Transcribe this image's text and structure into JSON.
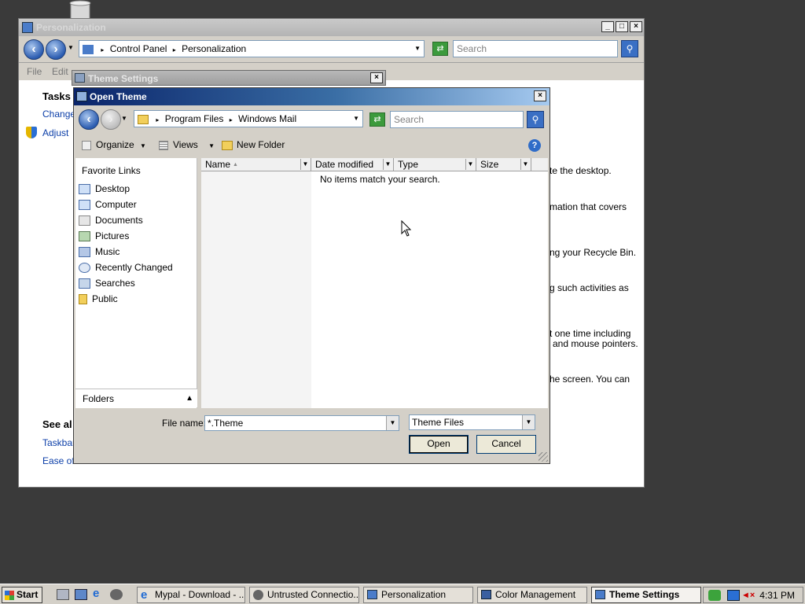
{
  "personalization": {
    "title": "Personalization",
    "address": {
      "crumb1": "Control Panel",
      "crumb2": "Personalization"
    },
    "search_placeholder": "Search",
    "menu": {
      "file": "File",
      "edit": "Edit"
    },
    "tasks_heading": "Tasks",
    "task_links": [
      "Change",
      "Adjust"
    ],
    "see_also": "See al",
    "see_also_links": [
      "Taskbar",
      "Ease of"
    ],
    "right_text": [
      "te the desktop.",
      "mation that covers",
      "ng your Recycle Bin.",
      "g such activities as",
      "t one time including",
      "and mouse pointers.",
      "he screen. You can"
    ]
  },
  "theme_settings": {
    "title": "Theme Settings"
  },
  "open_theme": {
    "title": "Open Theme",
    "address": {
      "crumb1": "Program Files",
      "crumb2": "Windows Mail"
    },
    "search_placeholder": "Search",
    "toolbar": {
      "organize": "Organize",
      "views": "Views",
      "new_folder": "New Folder"
    },
    "favorites_heading": "Favorite Links",
    "favorites": [
      {
        "label": "Desktop",
        "icon": "desktop-icon"
      },
      {
        "label": "Computer",
        "icon": "computer-icon"
      },
      {
        "label": "Documents",
        "icon": "documents-icon"
      },
      {
        "label": "Pictures",
        "icon": "pictures-icon"
      },
      {
        "label": "Music",
        "icon": "music-icon"
      },
      {
        "label": "Recently Changed",
        "icon": "recent-icon"
      },
      {
        "label": "Searches",
        "icon": "searches-icon"
      },
      {
        "label": "Public",
        "icon": "public-folder-icon"
      }
    ],
    "folders_label": "Folders",
    "columns": {
      "name": "Name",
      "date": "Date modified",
      "type": "Type",
      "size": "Size"
    },
    "empty_message": "No items match your search.",
    "filename_label": "File name:",
    "filename_value": "*.Theme",
    "filetype_value": "Theme Files",
    "open_button": "Open",
    "cancel_button": "Cancel"
  },
  "taskbar": {
    "start": "Start",
    "tasks": [
      {
        "label": "Mypal - Download - ..."
      },
      {
        "label": "Untrusted Connectio..."
      },
      {
        "label": "Personalization"
      },
      {
        "label": "Color Management"
      },
      {
        "label": "Theme Settings"
      }
    ],
    "clock": "4:31 PM"
  },
  "colors": {
    "title_active": "#0a246a",
    "desktop": "#3a3a3a",
    "link": "#0b3ea8"
  }
}
